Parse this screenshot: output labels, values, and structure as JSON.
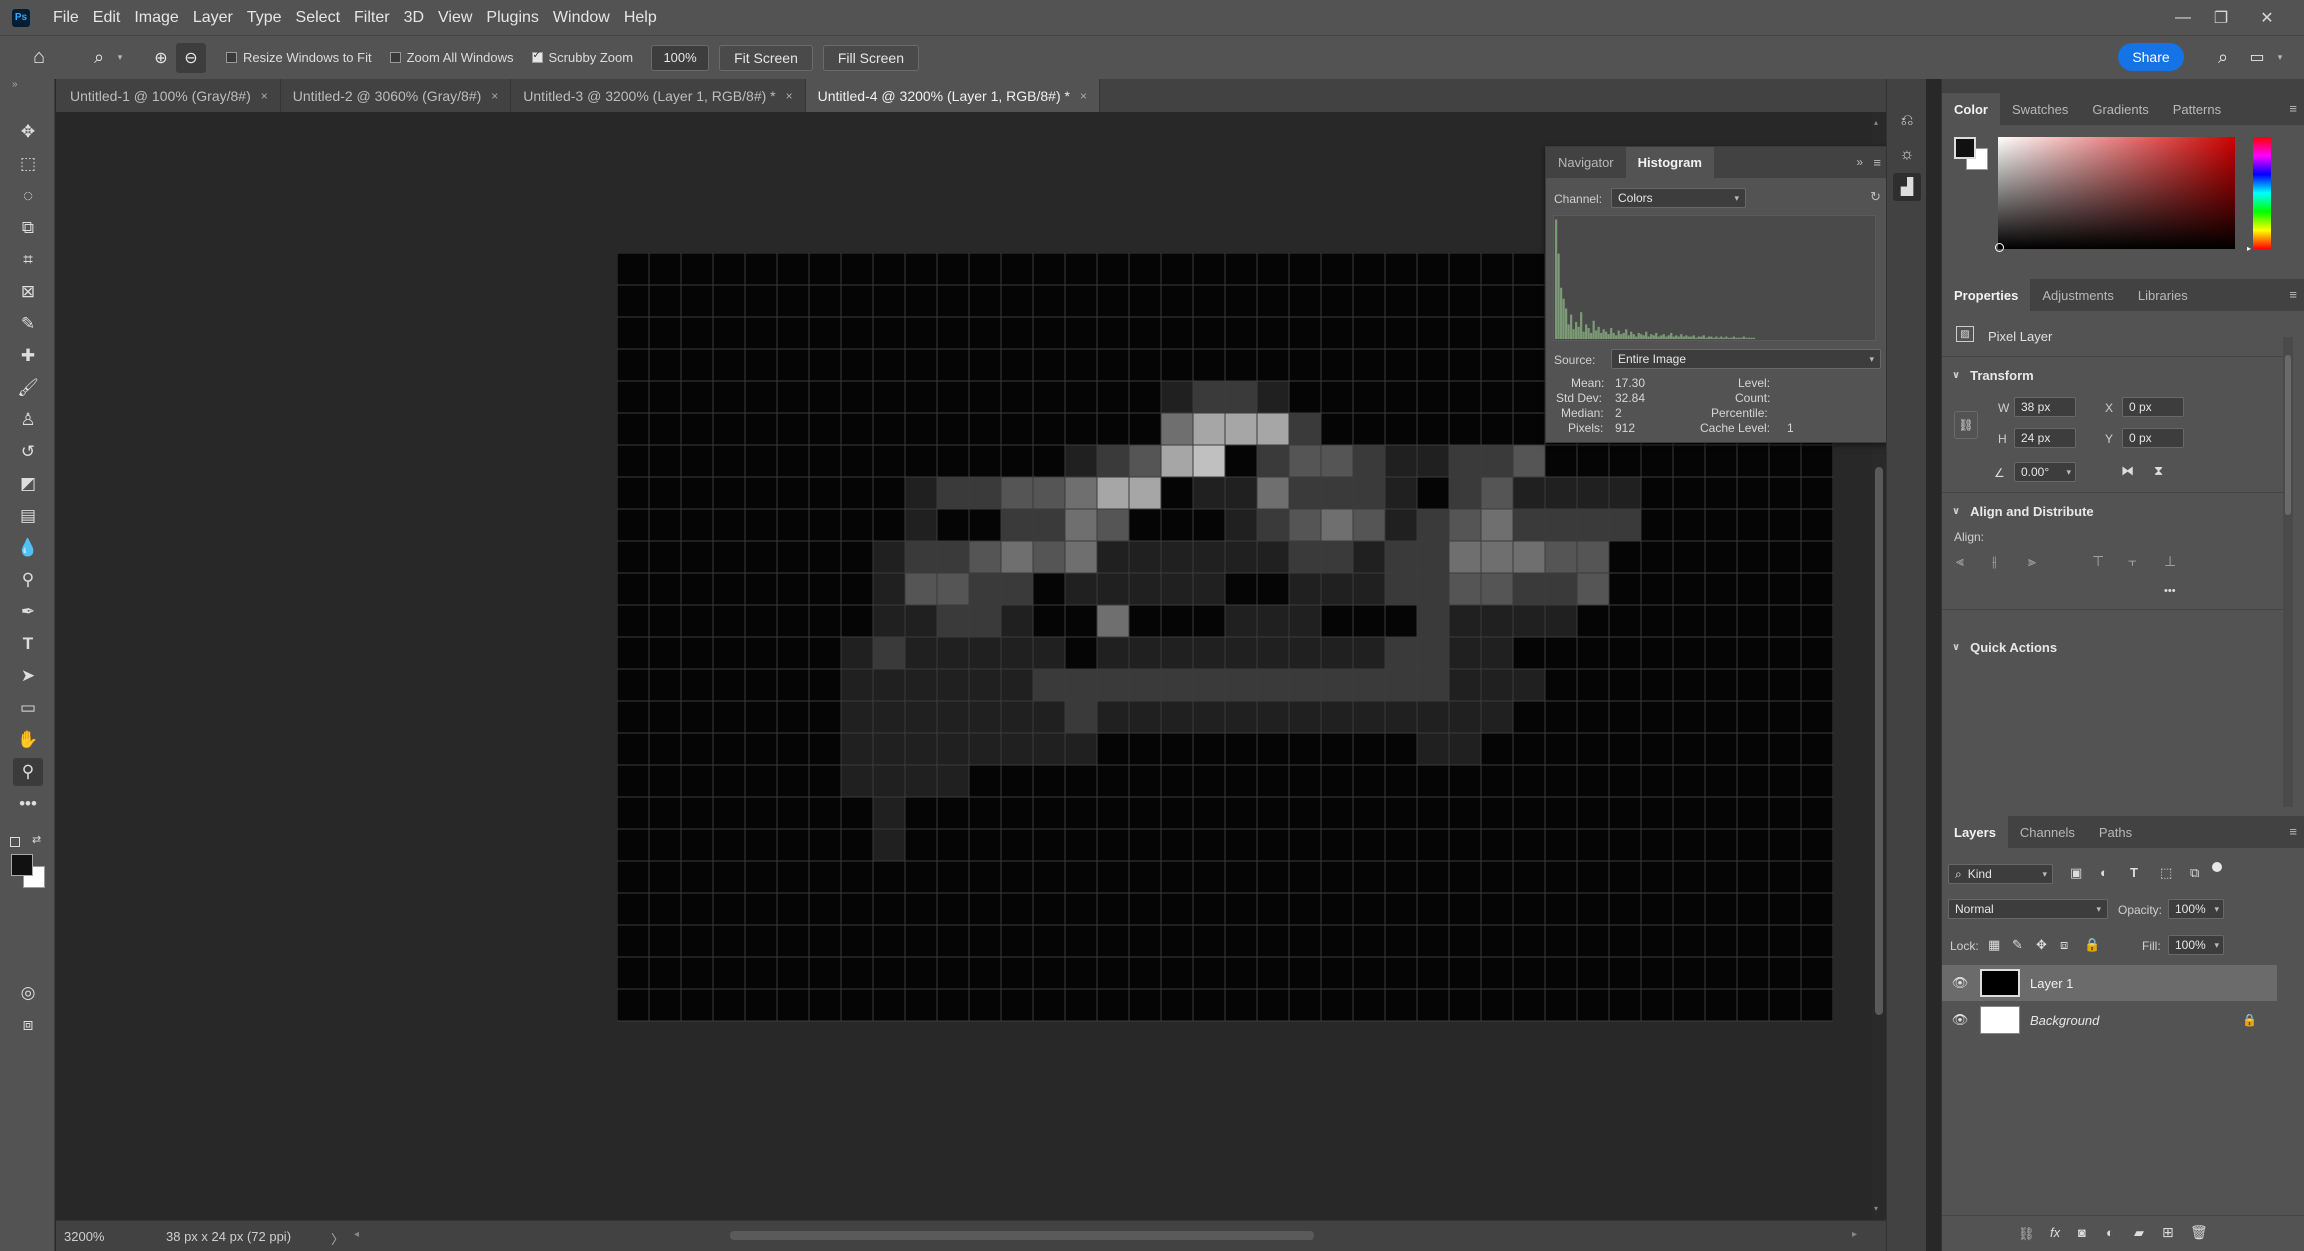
{
  "app": {
    "logo": "Ps",
    "menu": [
      "File",
      "Edit",
      "Image",
      "Layer",
      "Type",
      "Select",
      "Filter",
      "3D",
      "View",
      "Plugins",
      "Window",
      "Help"
    ],
    "window_controls": [
      "minimize-icon",
      "maximize-icon",
      "close-icon"
    ]
  },
  "options_bar": {
    "resize_windows": "Resize Windows to Fit",
    "zoom_all": "Zoom All Windows",
    "scrubby_zoom": "Scrubby Zoom",
    "zoom_value": "100%",
    "fit_screen": "Fit Screen",
    "fill_screen": "Fill Screen",
    "share": "Share"
  },
  "tabs": [
    {
      "label": "Untitled-1 @ 100% (Gray/8#)",
      "close": "×"
    },
    {
      "label": "Untitled-2 @ 3060% (Gray/8#)",
      "close": "×"
    },
    {
      "label": "Untitled-3 @ 3200% (Layer 1, RGB/8#) *",
      "close": "×"
    },
    {
      "label": "Untitled-4 @ 3200% (Layer 1, RGB/8#) *",
      "close": "×"
    }
  ],
  "status_bar": {
    "zoom": "3200%",
    "doc_info": "38 px x 24 px (72 ppi)",
    "arrow": "〉"
  },
  "histogram": {
    "tabs": [
      "Navigator",
      "Histogram"
    ],
    "channel_label": "Channel:",
    "channel_value": "Colors",
    "source_label": "Source:",
    "source_value": "Entire Image",
    "stats": {
      "mean_label": "Mean:",
      "mean": "17.30",
      "stddev_label": "Std Dev:",
      "stddev": "32.84",
      "median_label": "Median:",
      "median": "2",
      "pixels_label": "Pixels:",
      "pixels": "912",
      "level_label": "Level:",
      "count_label": "Count:",
      "percentile_label": "Percentile:",
      "cache_label": "Cache Level:",
      "cache": "1"
    },
    "bars": [
      0.98,
      0.7,
      0.42,
      0.33,
      0.25,
      0.12,
      0.2,
      0.08,
      0.14,
      0.1,
      0.22,
      0.06,
      0.12,
      0.09,
      0.05,
      0.15,
      0.07,
      0.1,
      0.05,
      0.08,
      0.06,
      0.04,
      0.09,
      0.05,
      0.03,
      0.07,
      0.04,
      0.05,
      0.08,
      0.03,
      0.06,
      0.04,
      0.02,
      0.05,
      0.04,
      0.03,
      0.06,
      0.02,
      0.04,
      0.03,
      0.05,
      0.02,
      0.03,
      0.04,
      0.02,
      0.03,
      0.05,
      0.02,
      0.03,
      0.02,
      0.04,
      0.02,
      0.03,
      0.02,
      0.02,
      0.03,
      0.01,
      0.02,
      0.02,
      0.03,
      0.01,
      0.02,
      0.02,
      0.01,
      0.02,
      0.01,
      0.02,
      0.01,
      0.02,
      0.01,
      0.01,
      0.02,
      0.01,
      0.01,
      0.01,
      0.02,
      0.01,
      0.01,
      0.01,
      0.01
    ]
  },
  "color_panel": {
    "tabs": [
      "Color",
      "Swatches",
      "Gradients",
      "Patterns"
    ],
    "hue_color": "#d00000"
  },
  "properties": {
    "tabs": [
      "Properties",
      "Adjustments",
      "Libraries"
    ],
    "layer_type": "Pixel Layer",
    "transform_title": "Transform",
    "w_label": "W",
    "w": "38 px",
    "h_label": "H",
    "h": "24 px",
    "x_label": "X",
    "x": "0 px",
    "y_label": "Y",
    "y": "0 px",
    "angle": "0.00°",
    "align_title": "Align and Distribute",
    "align_label": "Align:",
    "more": "•••",
    "quick_actions": "Quick Actions"
  },
  "layers": {
    "tabs": [
      "Layers",
      "Channels",
      "Paths"
    ],
    "kind": "Kind",
    "blend_mode": "Normal",
    "opacity_label": "Opacity:",
    "opacity": "100%",
    "lock_label": "Lock:",
    "fill_label": "Fill:",
    "fill": "100%",
    "items": [
      {
        "name": "Layer 1",
        "selected": true
      },
      {
        "name": "Background",
        "selected": false
      }
    ]
  },
  "image": {
    "cols": 38,
    "rows": 24,
    "rows_data": [
      "00000000000000000000000000000000000000",
      "00000000000000000000000000000000000000",
      "00000000000000000000000000000000000000",
      "00000000000000000000000000000000000000",
      "00000000000000000122100000000000000000",
      "00000000000000000466620000000000000000",
      "00000000000000123670233211223000000000",
      "00000000012233466011422210231111000000",
      "00000000010022430001234312342222000000",
      "00000000122343411111122122444330000000",
      "00000000133220111110011122332230000000",
      "00000000112210040001110002111100000000",
      "00000001211111011111111122110000000000",
      "00000001111112222222222222111000000000",
      "00000001111111211111111111110000000000",
      "00000001111111100000000001100000000000",
      "00000001111000000000000000000000000000",
      "00000000100000000000000000000000000000",
      "00000000100000000000000000000000000000",
      "00000000000000000000000000000000000000",
      "00000000000000000000000000000000000000",
      "00000000000000000000000000000000000000",
      "00000000000000000000000000000000000000",
      "00000000000000000000000000000000000000"
    ]
  }
}
